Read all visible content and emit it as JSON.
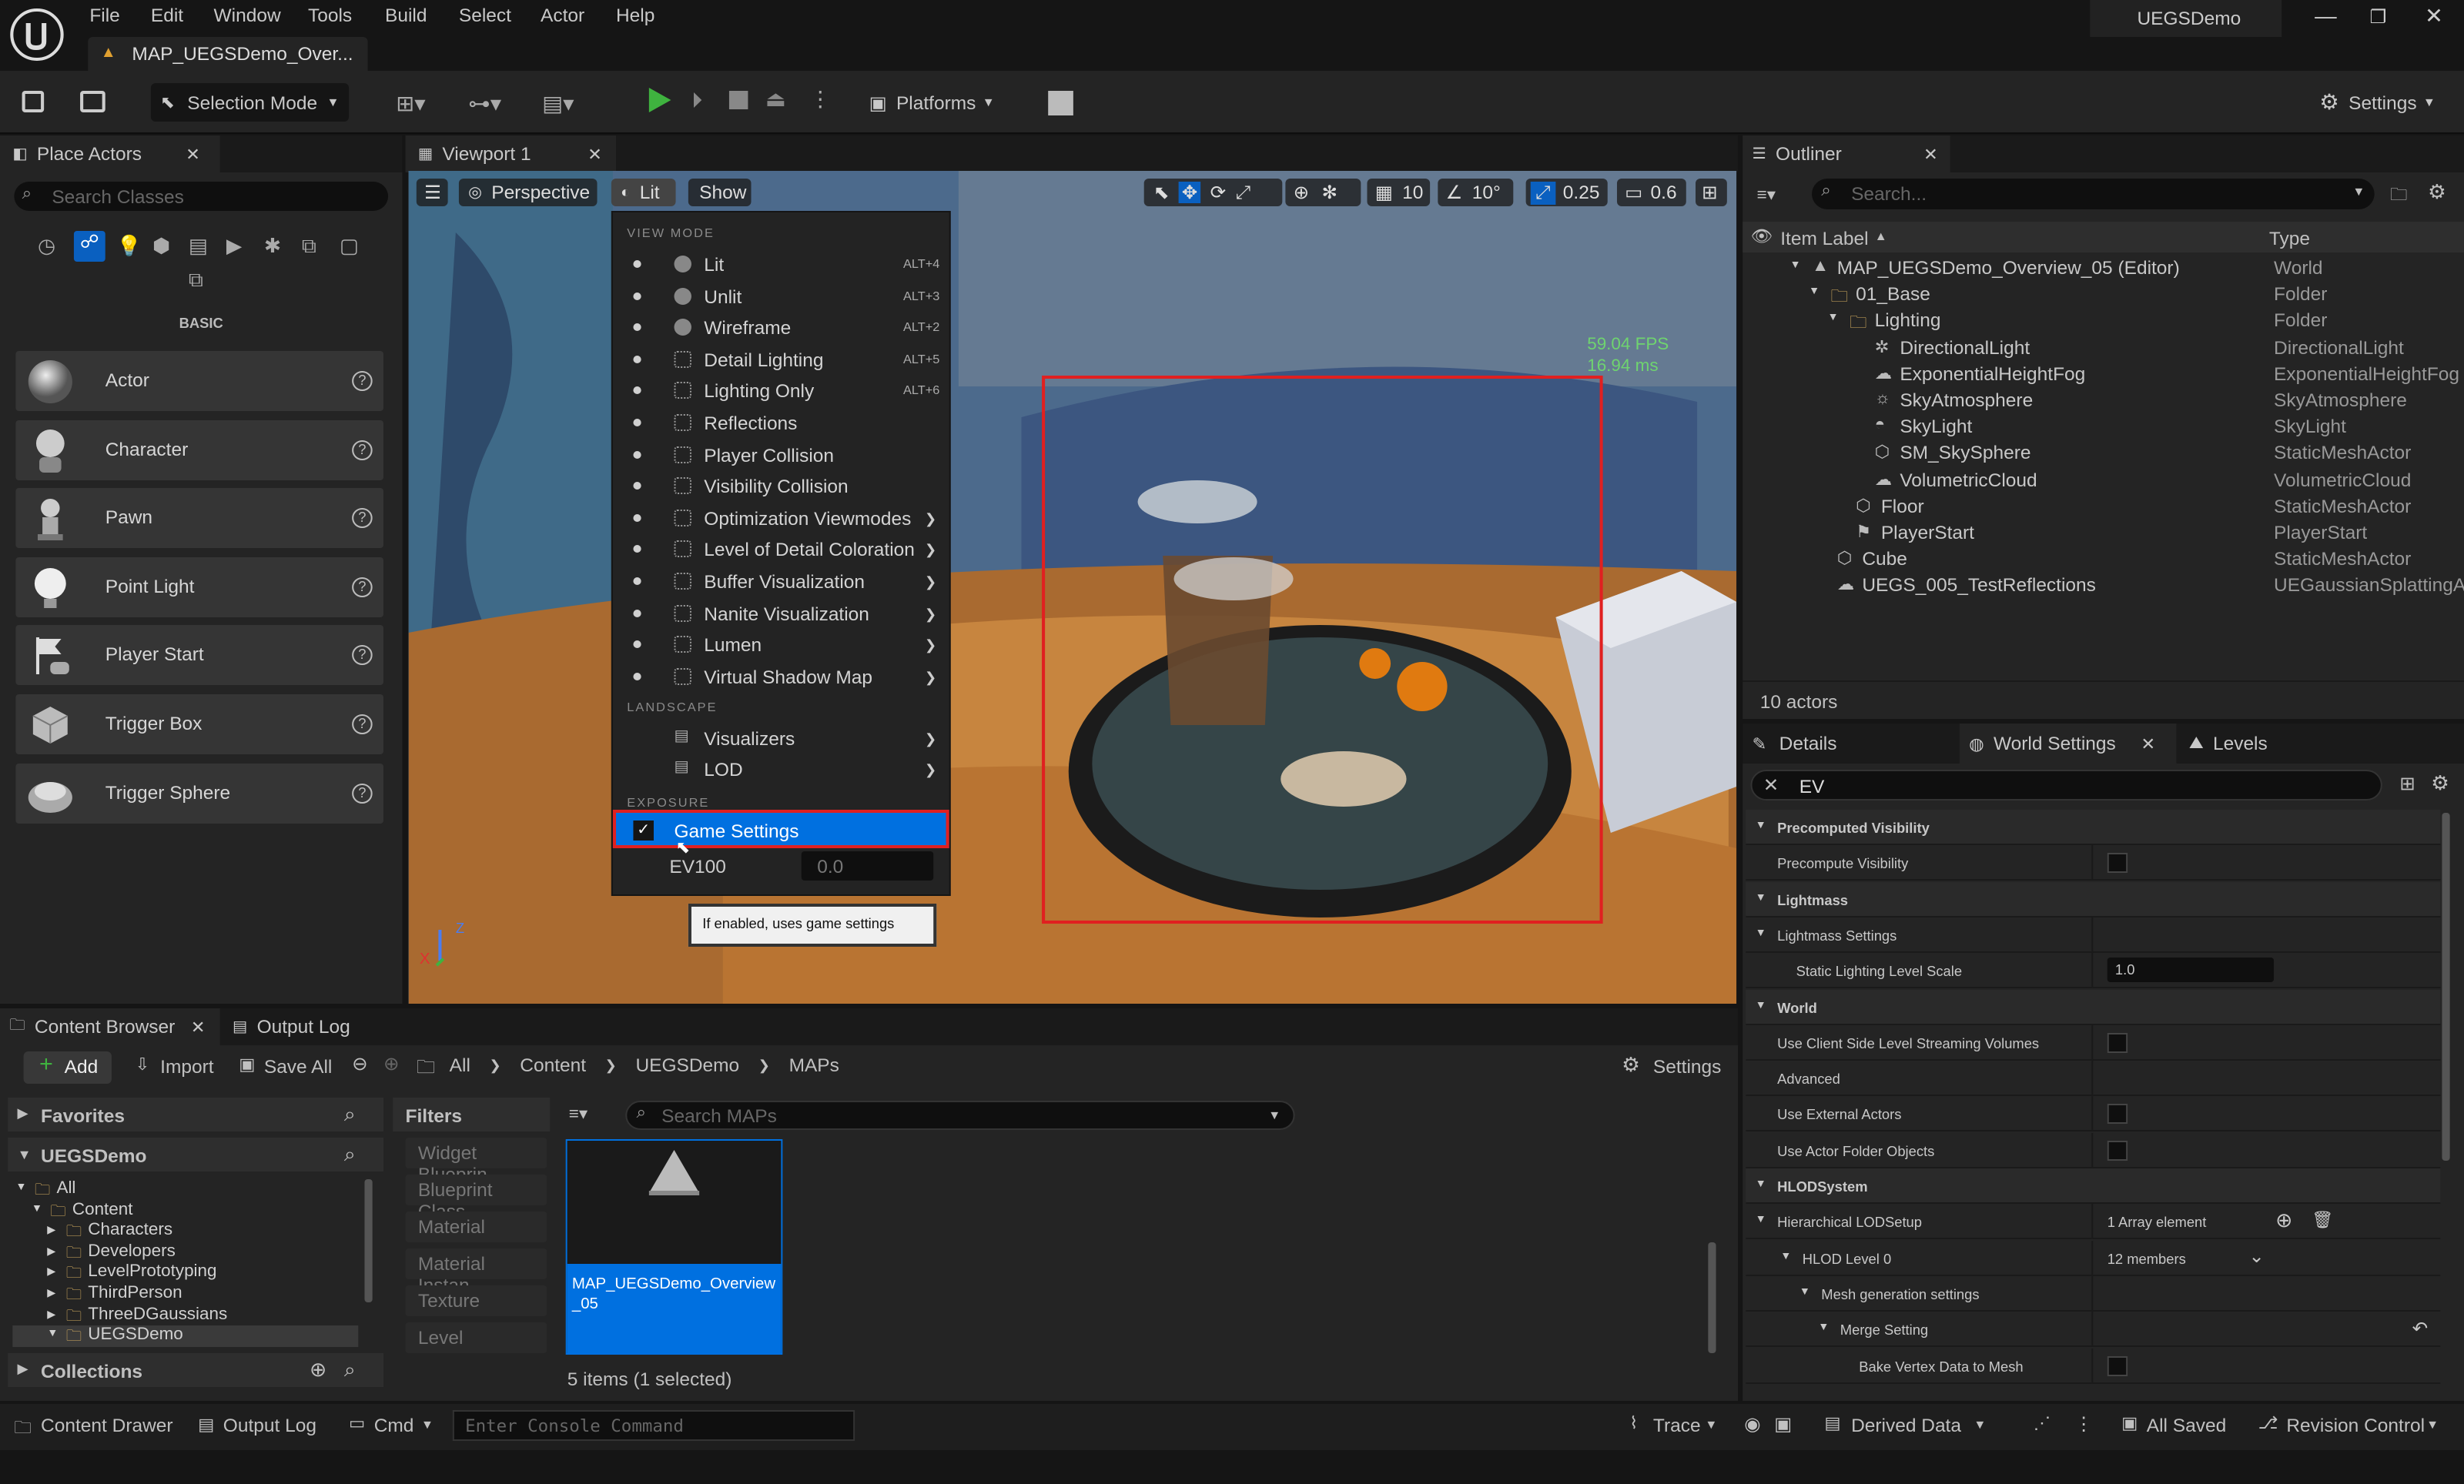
{
  "app": {
    "title": "UEGSDemo",
    "menus": [
      "File",
      "Edit",
      "Window",
      "Tools",
      "Build",
      "Select",
      "Actor",
      "Help"
    ],
    "doc_tab": "MAP_UEGSDemo_Over..."
  },
  "toolbar": {
    "selection_mode": "Selection Mode",
    "platforms": "Platforms",
    "settings": "Settings"
  },
  "place_actors": {
    "tab": "Place Actors",
    "search_placeholder": "Search Classes",
    "category": "BASIC",
    "items": [
      {
        "label": "Actor"
      },
      {
        "label": "Character"
      },
      {
        "label": "Pawn"
      },
      {
        "label": "Point Light"
      },
      {
        "label": "Player Start"
      },
      {
        "label": "Trigger Box"
      },
      {
        "label": "Trigger Sphere"
      }
    ]
  },
  "viewport": {
    "tab": "Viewport 1",
    "perspective": "Perspective",
    "lit": "Lit",
    "show": "Show",
    "grid": "10",
    "angle": "10°",
    "scale": "0.25",
    "camera_speed": "0.6",
    "fps": "59.04 FPS",
    "ms": "16.94 ms"
  },
  "view_mode_menu": {
    "section_view_mode": "VIEW MODE",
    "items": [
      {
        "label": "Lit",
        "key": "ALT+4",
        "sub": false
      },
      {
        "label": "Unlit",
        "key": "ALT+3",
        "sub": false
      },
      {
        "label": "Wireframe",
        "key": "ALT+2",
        "sub": false
      },
      {
        "label": "Detail Lighting",
        "key": "ALT+5",
        "sub": false
      },
      {
        "label": "Lighting Only",
        "key": "ALT+6",
        "sub": false
      },
      {
        "label": "Reflections",
        "key": "",
        "sub": false
      },
      {
        "label": "Player Collision",
        "key": "",
        "sub": false
      },
      {
        "label": "Visibility Collision",
        "key": "",
        "sub": false
      },
      {
        "label": "Optimization Viewmodes",
        "key": "",
        "sub": true
      },
      {
        "label": "Level of Detail Coloration",
        "key": "",
        "sub": true
      },
      {
        "label": "Buffer Visualization",
        "key": "",
        "sub": true
      },
      {
        "label": "Nanite Visualization",
        "key": "",
        "sub": true
      },
      {
        "label": "Lumen",
        "key": "",
        "sub": true
      },
      {
        "label": "Virtual Shadow Map",
        "key": "",
        "sub": true
      }
    ],
    "section_landscape": "LANDSCAPE",
    "landscape_items": [
      {
        "label": "Visualizers"
      },
      {
        "label": "LOD"
      }
    ],
    "section_exposure": "EXPOSURE",
    "game_settings": "Game Settings",
    "ev100_label": "EV100",
    "ev100_value": "0.0",
    "tooltip": "If enabled, uses game settings"
  },
  "outliner": {
    "tab": "Outliner",
    "search_placeholder": "Search...",
    "col_label": "Item Label",
    "col_type": "Type",
    "count": "10 actors",
    "rows": [
      {
        "name": "MAP_UEGSDemo_Overview_05 (Editor)",
        "type": "World"
      },
      {
        "name": "01_Base",
        "type": "Folder"
      },
      {
        "name": "Lighting",
        "type": "Folder"
      },
      {
        "name": "DirectionalLight",
        "type": "DirectionalLight"
      },
      {
        "name": "ExponentialHeightFog",
        "type": "ExponentialHeightFog"
      },
      {
        "name": "SkyAtmosphere",
        "type": "SkyAtmosphere"
      },
      {
        "name": "SkyLight",
        "type": "SkyLight"
      },
      {
        "name": "SM_SkySphere",
        "type": "StaticMeshActor"
      },
      {
        "name": "VolumetricCloud",
        "type": "VolumetricCloud"
      },
      {
        "name": "Floor",
        "type": "StaticMeshActor"
      },
      {
        "name": "PlayerStart",
        "type": "PlayerStart"
      },
      {
        "name": "Cube",
        "type": "StaticMeshActor"
      },
      {
        "name": "UEGS_005_TestReflections",
        "type": "UEGaussianSplattingAc"
      }
    ]
  },
  "details": {
    "tab_details": "Details",
    "tab_world": "World Settings",
    "tab_levels": "Levels",
    "filter": "EV",
    "rows": [
      {
        "label": "Precomputed Visibility",
        "cat": true,
        "value": ""
      },
      {
        "label": "Precompute Visibility",
        "cat": false,
        "value": ""
      },
      {
        "label": "Lightmass",
        "cat": true,
        "value": ""
      },
      {
        "label": "Lightmass Settings",
        "cat": false,
        "value": ""
      },
      {
        "label": "Static Lighting Level Scale",
        "cat": false,
        "value": "1.0"
      },
      {
        "label": "World",
        "cat": true,
        "value": ""
      },
      {
        "label": "Use Client Side Level Streaming Volumes",
        "cat": false,
        "value": ""
      },
      {
        "label": "Advanced",
        "cat": false,
        "value": ""
      },
      {
        "label": "Use External Actors",
        "cat": false,
        "value": ""
      },
      {
        "label": "Use Actor Folder Objects",
        "cat": false,
        "value": ""
      },
      {
        "label": "HLODSystem",
        "cat": true,
        "value": ""
      },
      {
        "label": "Hierarchical LODSetup",
        "cat": false,
        "value": "1 Array element"
      },
      {
        "label": "HLOD Level 0",
        "cat": false,
        "value": "12 members"
      },
      {
        "label": "Mesh generation settings",
        "cat": false,
        "value": ""
      },
      {
        "label": "Merge Setting",
        "cat": false,
        "value": ""
      },
      {
        "label": "Bake Vertex Data to Mesh",
        "cat": false,
        "value": ""
      }
    ]
  },
  "content_browser": {
    "tab": "Content Browser",
    "tab_output": "Output Log",
    "add": "Add",
    "import": "Import",
    "save_all": "Save All",
    "settings": "Settings",
    "breadcrumb": [
      "All",
      "Content",
      "UEGSDemo",
      "MAPs"
    ],
    "favorites": "Favorites",
    "project": "UEGSDemo",
    "collections": "Collections",
    "filters": "Filters",
    "search_placeholder": "Search MAPs",
    "tree": [
      "All",
      "Content",
      "Characters",
      "Developers",
      "LevelPrototyping",
      "ThirdPerson",
      "ThreeDGaussians",
      "UEGSDemo"
    ],
    "filter_items": [
      "Widget Blueprin",
      "Blueprint Class",
      "Material",
      "Material Instan",
      "Texture",
      "Level"
    ],
    "asset_name": "MAP_UEGSDemo_Overview_05",
    "status": "5 items (1 selected)"
  },
  "statusbar": {
    "content_drawer": "Content Drawer",
    "output_log": "Output Log",
    "cmd": "Cmd",
    "console_placeholder": "Enter Console Command",
    "trace": "Trace",
    "derived_data": "Derived Data",
    "all_saved": "All Saved",
    "revision_control": "Revision Control"
  },
  "colors": {
    "accent": "#0070e0",
    "selection_red": "#e02020",
    "play_green": "#3fb33f"
  }
}
